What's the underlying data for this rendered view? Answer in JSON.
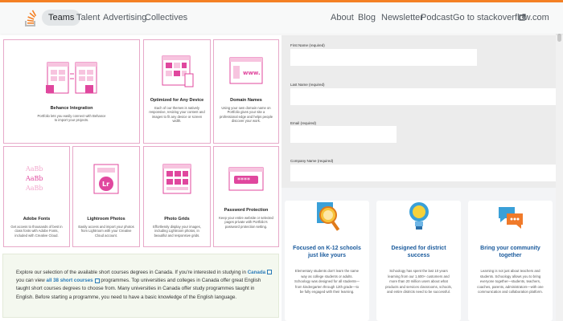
{
  "nav": {
    "left": [
      "Teams",
      "Talent",
      "Advertising",
      "Collectives"
    ],
    "right": [
      "About",
      "Blog",
      "Newsletter",
      "Podcast",
      "Go to stackoverflow.com"
    ]
  },
  "features": [
    {
      "title": "Behance Integration",
      "desc": "Portfolio lets you easily connect with Behance to import your projects.",
      "icon": "behance-integration-icon"
    },
    {
      "title": "Optimized for Any Device",
      "desc": "Each of our themes is natively responsive, resizing your content and images to fit any device or screen width.",
      "icon": "device-grid-icon"
    },
    {
      "title": "Domain Names",
      "desc": "Using your own domain name on Portfolio gives your site a professional edge and helps people discover your work.",
      "icon": "domain-www-icon"
    },
    {
      "title": "Adobe Fonts",
      "desc": "Get access to thousands of best in class fonts with Adobe Fonts, included with Creative Cloud.",
      "icon": "adobe-fonts-icon"
    },
    {
      "title": "Lightroom Photos",
      "desc": "Easily access and import your photos from Lightroom with your Creative Cloud account.",
      "icon": "lightroom-icon"
    },
    {
      "title": "Photo Grids",
      "desc": "Effortlessly display your images, including Lightroom photos, in beautiful and responsive grids.",
      "icon": "photo-grid-icon"
    },
    {
      "title": "Password Protection",
      "desc": "Keep your entire website or selected pages private with Portfolio's password protection setting.",
      "icon": "password-icon"
    }
  ],
  "form": {
    "fields": [
      {
        "label": "First Name (required)",
        "value": ""
      },
      {
        "label": "Last Name (required)",
        "value": ""
      },
      {
        "label": "Email (required)",
        "value": ""
      },
      {
        "label": "Company Name (required)",
        "value": ""
      }
    ]
  },
  "school_cards": [
    {
      "title": "Focused on K-12 schools just like yours",
      "desc": "Elementary students don't learn the same way as college students or adults. Schoology was designed for all students—from kindergarten through 12th grade—to be fully engaged with their learning.",
      "icon": "magnifier-icon"
    },
    {
      "title": "Designed for district success",
      "desc": "Schoology has spent the last 10 years learning from our 1,600+ customers and more than 20 million users about what products and services classrooms, schools, and entire districts need to be successful.",
      "icon": "lightbulb-icon"
    },
    {
      "title": "Bring your community together",
      "desc": "Learning is not just about teachers and students. Schoology allows you to bring everyone together—students, teachers, coaches, parents, administrators—with one communication and collaboration platform.",
      "icon": "chat-bubbles-icon"
    }
  ],
  "courses": {
    "t1": "Explore our selection of the available short courses degrees in Canada. If you're interested in studying in ",
    "l1": "Canada",
    "t2": " you can view ",
    "l2": "all 38 short courses",
    "t3": " programmes. Top universities and colleges in Canada offer great English taught short courses degrees to choose from. Many universities in Canada offer study programmes taught in English. Before starting a programme, you need to have a basic knowledge of the English language."
  },
  "colors": {
    "accent": "#f48024",
    "pink": "#e0479e",
    "link": "#2a7ab8",
    "schoolTitle": "#1a5a9c"
  }
}
